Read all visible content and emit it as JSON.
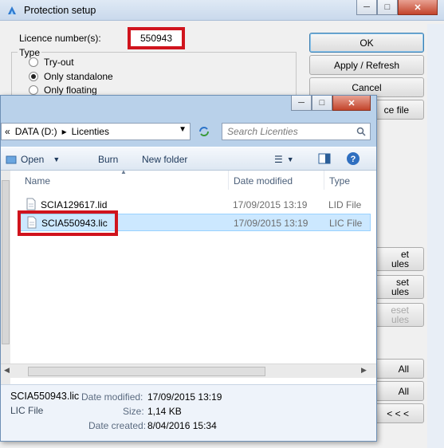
{
  "protection_setup": {
    "title": "Protection setup",
    "licence_label": "Licence number(s):",
    "licence_value": "550943",
    "type_group": {
      "legend": "Type",
      "options": [
        {
          "label": "Try-out",
          "checked": false
        },
        {
          "label": "Only standalone",
          "checked": true
        },
        {
          "label": "Only floating",
          "checked": false
        }
      ]
    },
    "buttons": {
      "ok": "OK",
      "apply_refresh": "Apply / Refresh",
      "cancel": "Cancel",
      "file_partial": "ce file",
      "set_modules_1": "et\nules",
      "set_modules_2": "set\nules",
      "reset_modules": "eset\nules",
      "all_1": "All",
      "all_2": "All",
      "back": "< < <"
    }
  },
  "file_dialog": {
    "address": {
      "prefix": "«",
      "drive": "DATA (D:)",
      "folder": "Licenties"
    },
    "search_placeholder": "Search Licenties",
    "toolbar": {
      "open": "Open",
      "burn": "Burn",
      "new_folder": "New folder"
    },
    "columns": {
      "name": "Name",
      "date_modified": "Date modified",
      "type": "Type"
    },
    "files": [
      {
        "name": "SCIA129617.lid",
        "date": "17/09/2015 13:19",
        "type": "LID File",
        "selected": false
      },
      {
        "name": "SCIA550943.lic",
        "date": "17/09/2015 13:19",
        "type": "LIC File",
        "selected": true
      }
    ],
    "details": {
      "file_name": "SCIA550943.lic",
      "file_type": "LIC File",
      "date_modified_label": "Date modified:",
      "date_modified": "17/09/2015 13:19",
      "size_label": "Size:",
      "size": "1,14 KB",
      "date_created_label": "Date created:",
      "date_created": "8/04/2016 15:34"
    }
  },
  "colors": {
    "highlight_red": "#d0141d",
    "selection": "#cce8ff"
  }
}
